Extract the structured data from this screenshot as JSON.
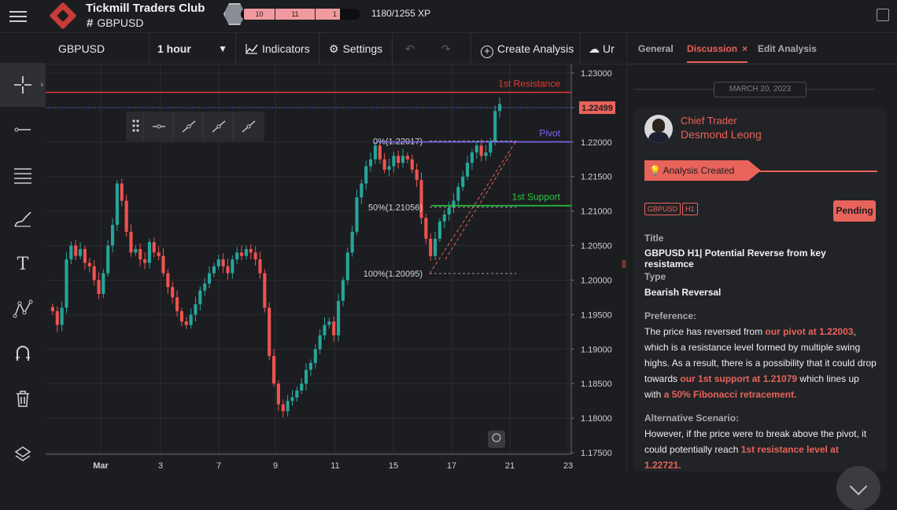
{
  "header": {
    "club_name": "Tickmill Traders Club",
    "channel": "GBPUSD",
    "channel_prefix": "#",
    "xp_segments": [
      "10",
      "11",
      "1"
    ],
    "xp_text": "1180/1255 XP"
  },
  "toolbar": {
    "symbol": "GBPUSD",
    "interval": "1 hour",
    "indicators_label": "Indicators",
    "settings_label": "Settings",
    "create_label": "Create Analysis",
    "upload_label": "Ur"
  },
  "chart_data": {
    "type": "candlestick",
    "symbol": "GBPUSD",
    "ylim": [
      1.175,
      1.23
    ],
    "y_ticks": [
      "1.23000",
      "1.22500",
      "1.22000",
      "1.21500",
      "1.21000",
      "1.20500",
      "1.20000",
      "1.19500",
      "1.19000",
      "1.18500",
      "1.18000",
      "1.17500"
    ],
    "x_ticks": [
      "Mar",
      "3",
      "7",
      "9",
      "11",
      "15",
      "17",
      "21",
      "23"
    ],
    "last_price": "1.22499",
    "levels": [
      {
        "name": "1st Resistance",
        "value": 1.22721,
        "color": "#e53935"
      },
      {
        "name": "Pivot",
        "value": 1.22003,
        "color": "#7b68ee"
      },
      {
        "name": "1st Support",
        "value": 1.21079,
        "color": "#27c93f"
      }
    ],
    "fibonacci": [
      {
        "label": "0%(1.22017)",
        "value": 1.22017
      },
      {
        "label": "50%(1.21056)",
        "value": 1.21056
      },
      {
        "label": "100%(1.20095)",
        "value": 1.20095
      }
    ],
    "up_color": "#26a69a",
    "down_color": "#ef5350",
    "closes": [
      1.1955,
      1.1935,
      1.196,
      1.203,
      1.205,
      1.2035,
      1.2045,
      1.2025,
      1.202,
      1.2,
      1.198,
      1.201,
      1.205,
      1.208,
      1.214,
      1.2115,
      1.207,
      1.204,
      1.2045,
      1.203,
      1.2025,
      1.2055,
      1.204,
      1.2035,
      1.201,
      1.199,
      1.1975,
      1.1955,
      1.194,
      1.1935,
      1.195,
      1.1965,
      1.1985,
      1.1995,
      1.201,
      1.202,
      1.203,
      1.202,
      1.201,
      1.203,
      1.204,
      1.2035,
      1.2045,
      1.204,
      1.203,
      1.201,
      1.196,
      1.189,
      1.185,
      1.182,
      1.181,
      1.1825,
      1.183,
      1.184,
      1.185,
      1.187,
      1.188,
      1.19,
      1.192,
      1.1935,
      1.194,
      1.192,
      1.197,
      1.2,
      1.204,
      1.207,
      1.212,
      1.214,
      1.2165,
      1.2175,
      1.2195,
      1.2175,
      1.216,
      1.2165,
      1.218,
      1.217,
      1.218,
      1.2175,
      1.216,
      1.2145,
      1.209,
      1.206,
      1.2035,
      1.206,
      1.2085,
      1.2095,
      1.2105,
      1.2115,
      1.2135,
      1.215,
      1.217,
      1.2185,
      1.2195,
      1.218,
      1.2185,
      1.22,
      1.2245,
      1.2255
    ]
  },
  "left_tools": [
    {
      "name": "crosshair",
      "icon": "crosshair-icon"
    },
    {
      "name": "line",
      "icon": "line-tool-icon"
    },
    {
      "name": "fib",
      "icon": "fib-tool-icon"
    },
    {
      "name": "brush",
      "icon": "brush-icon"
    },
    {
      "name": "text",
      "icon": "text-icon",
      "glyph": "T"
    },
    {
      "name": "pattern",
      "icon": "pattern-icon"
    },
    {
      "name": "magnet",
      "icon": "magnet-icon"
    },
    {
      "name": "trash",
      "icon": "trash-icon"
    },
    {
      "name": "layers",
      "icon": "layers-icon"
    }
  ],
  "panel": {
    "tabs": [
      "General",
      "Discussion",
      "Edit Analysis"
    ],
    "date": "MARCH 20, 2023",
    "role": "Chief Trader",
    "author": "Desmond Leong",
    "created_label": "Analysis Created",
    "tags": [
      "GBPUSD",
      "H1"
    ],
    "status": "Pending",
    "title_label": "Title",
    "title_value": "GBPUSD H1| Potential Reverse from key resistamce",
    "type_label": "Type",
    "type_value": "Bearish Reversal",
    "pref_label": "Preference:",
    "pref_parts": [
      "The price has reversed from ",
      "our pivot at 1.22003",
      ", which is a resistance level formed by multiple swing highs. As a result, there is a possibility that it could drop towards ",
      "our 1st support at 1.21079",
      " which lines up with ",
      "a 50% Fibonacci retracement."
    ],
    "alt_label": "Alternative Scenario:",
    "alt_parts": [
      "However, if the price were to break above the pivot, it could potentially reach ",
      "1st resistance level at 1.22721."
    ]
  }
}
